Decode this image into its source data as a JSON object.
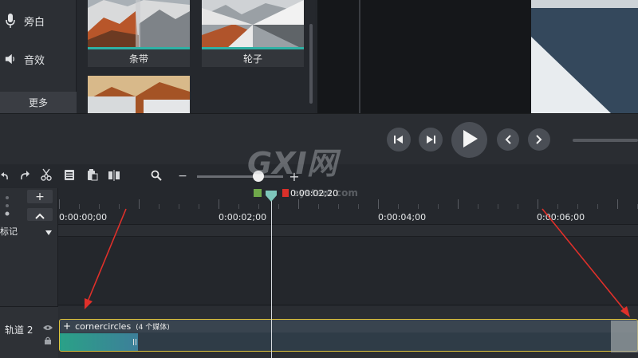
{
  "left_nav": {
    "items": [
      {
        "label": "旁白",
        "icon": "microphone-icon"
      },
      {
        "label": "音效",
        "icon": "speaker-icon"
      }
    ],
    "more_label": "更多"
  },
  "media_bin": {
    "thumbnails": [
      {
        "caption": "条带"
      },
      {
        "caption": "轮子"
      },
      {
        "caption": ""
      }
    ]
  },
  "player": {
    "buttons": [
      "step-back-icon",
      "step-forward-icon",
      "play-icon",
      "prev-icon",
      "next-icon"
    ]
  },
  "watermark": {
    "text": "GXI网",
    "sub": "system.com"
  },
  "toolbar": {
    "tools": [
      "undo-icon",
      "redo-icon",
      "cut-icon",
      "copy-icon",
      "paste-icon",
      "split-icon",
      "search-icon"
    ],
    "zoom_minus": "−",
    "zoom_plus": "+"
  },
  "timeline": {
    "playhead_time": "0:00:02;20",
    "ruler_labels": [
      "0:00:00;00",
      "0:00:02;00",
      "0:00:04;00",
      "0:00:06;00"
    ],
    "add_track": "+",
    "markers_label": "标记",
    "tracks": [
      {
        "label": "轨道 2"
      }
    ],
    "clip": {
      "plus": "+",
      "name": "cornercircles",
      "count": "(4 个媒体)"
    }
  },
  "colors": {
    "accent_teal": "#2fb1a4",
    "clip_border": "#e3c53a",
    "arrow_red": "#e0302a",
    "playhead_green": "#6fa84a",
    "playhead_red": "#d9302a"
  }
}
